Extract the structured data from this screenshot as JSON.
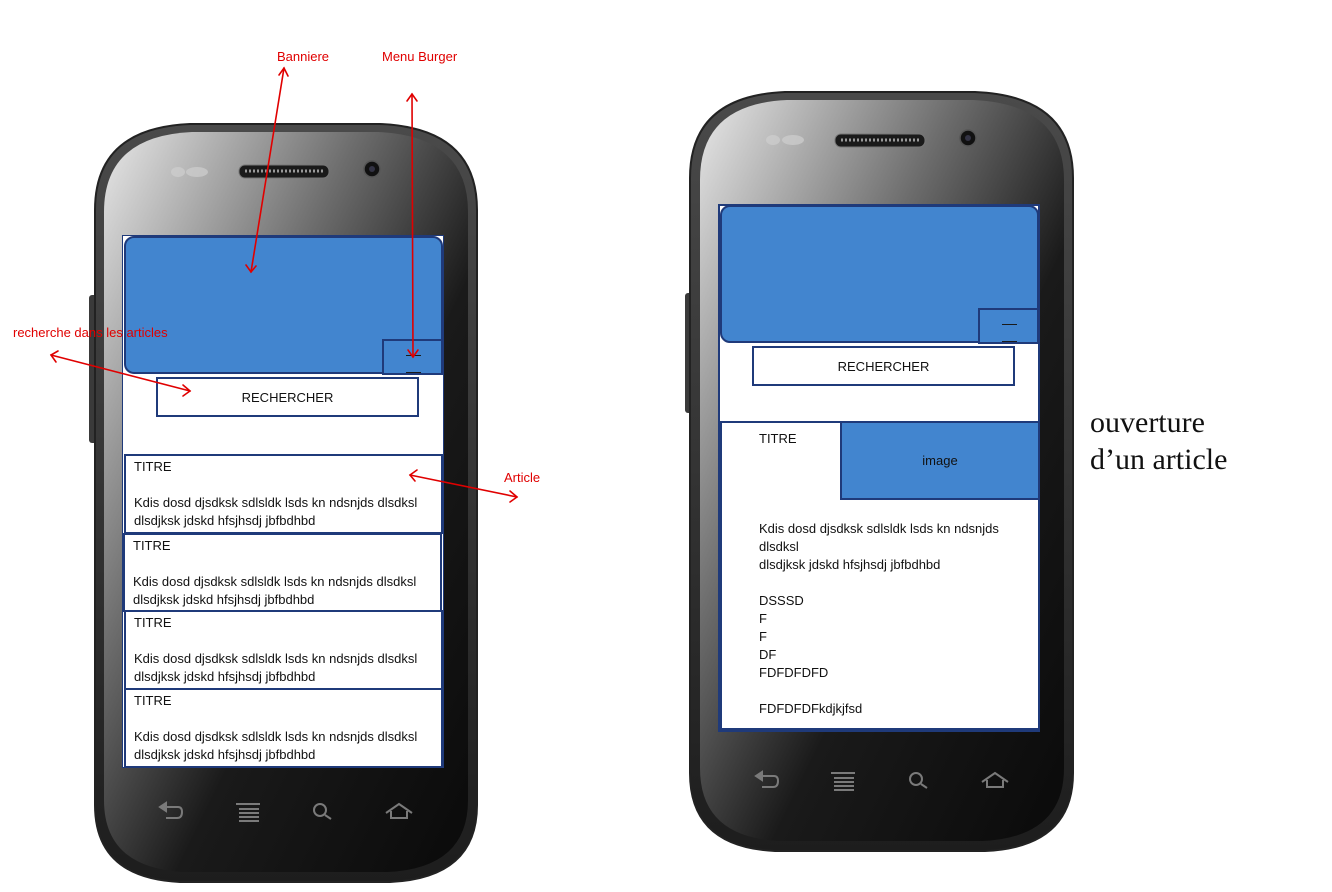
{
  "annotations": {
    "banner": "Banniere",
    "burger": "Menu Burger",
    "search": "recherche dans les articles",
    "article": "Article"
  },
  "left_phone": {
    "search_label": "RECHERCHER",
    "articles": [
      {
        "title": "TITRE",
        "body": "Kdis dosd djsdksk sdlsldk lsds kn ndsnjds dlsdksl\ndlsdjksk jdskd hfsjhsdj jbfbdhbd"
      },
      {
        "title": "TITRE",
        "body": "Kdis dosd djsdksk sdlsldk lsds kn ndsnjds dlsdksl\ndlsdjksk jdskd hfsjhsdj jbfbdhbd"
      },
      {
        "title": "TITRE",
        "body": "Kdis dosd djsdksk sdlsldk lsds kn ndsnjds dlsdksl\ndlsdjksk jdskd hfsjhsdj jbfbdhbd"
      },
      {
        "title": "TITRE",
        "body": "Kdis dosd djsdksk sdlsldk lsds kn ndsnjds dlsdksl\ndlsdjksk jdskd hfsjhsdj jbfbdhbd"
      }
    ]
  },
  "right_phone": {
    "search_label": "RECHERCHER",
    "article": {
      "title": "TITRE",
      "image_label": "image",
      "body": "Kdis dosd djsdksk sdlsldk lsds kn ndsnjds\ndlsdksl\ndlsdjksk jdskd hfsjhsdj jbfbdhbd\n\nDSSSD\nF\nF\nDF\nFDFDFDFD\n\nFDFDFDFkdjkjfsd"
    }
  },
  "caption": {
    "line1": "ouverture",
    "line2": "d’un  article"
  },
  "colors": {
    "banner_fill": "#4285cf",
    "frame_border": "#1f3a7a",
    "annotation": "#e00000"
  }
}
